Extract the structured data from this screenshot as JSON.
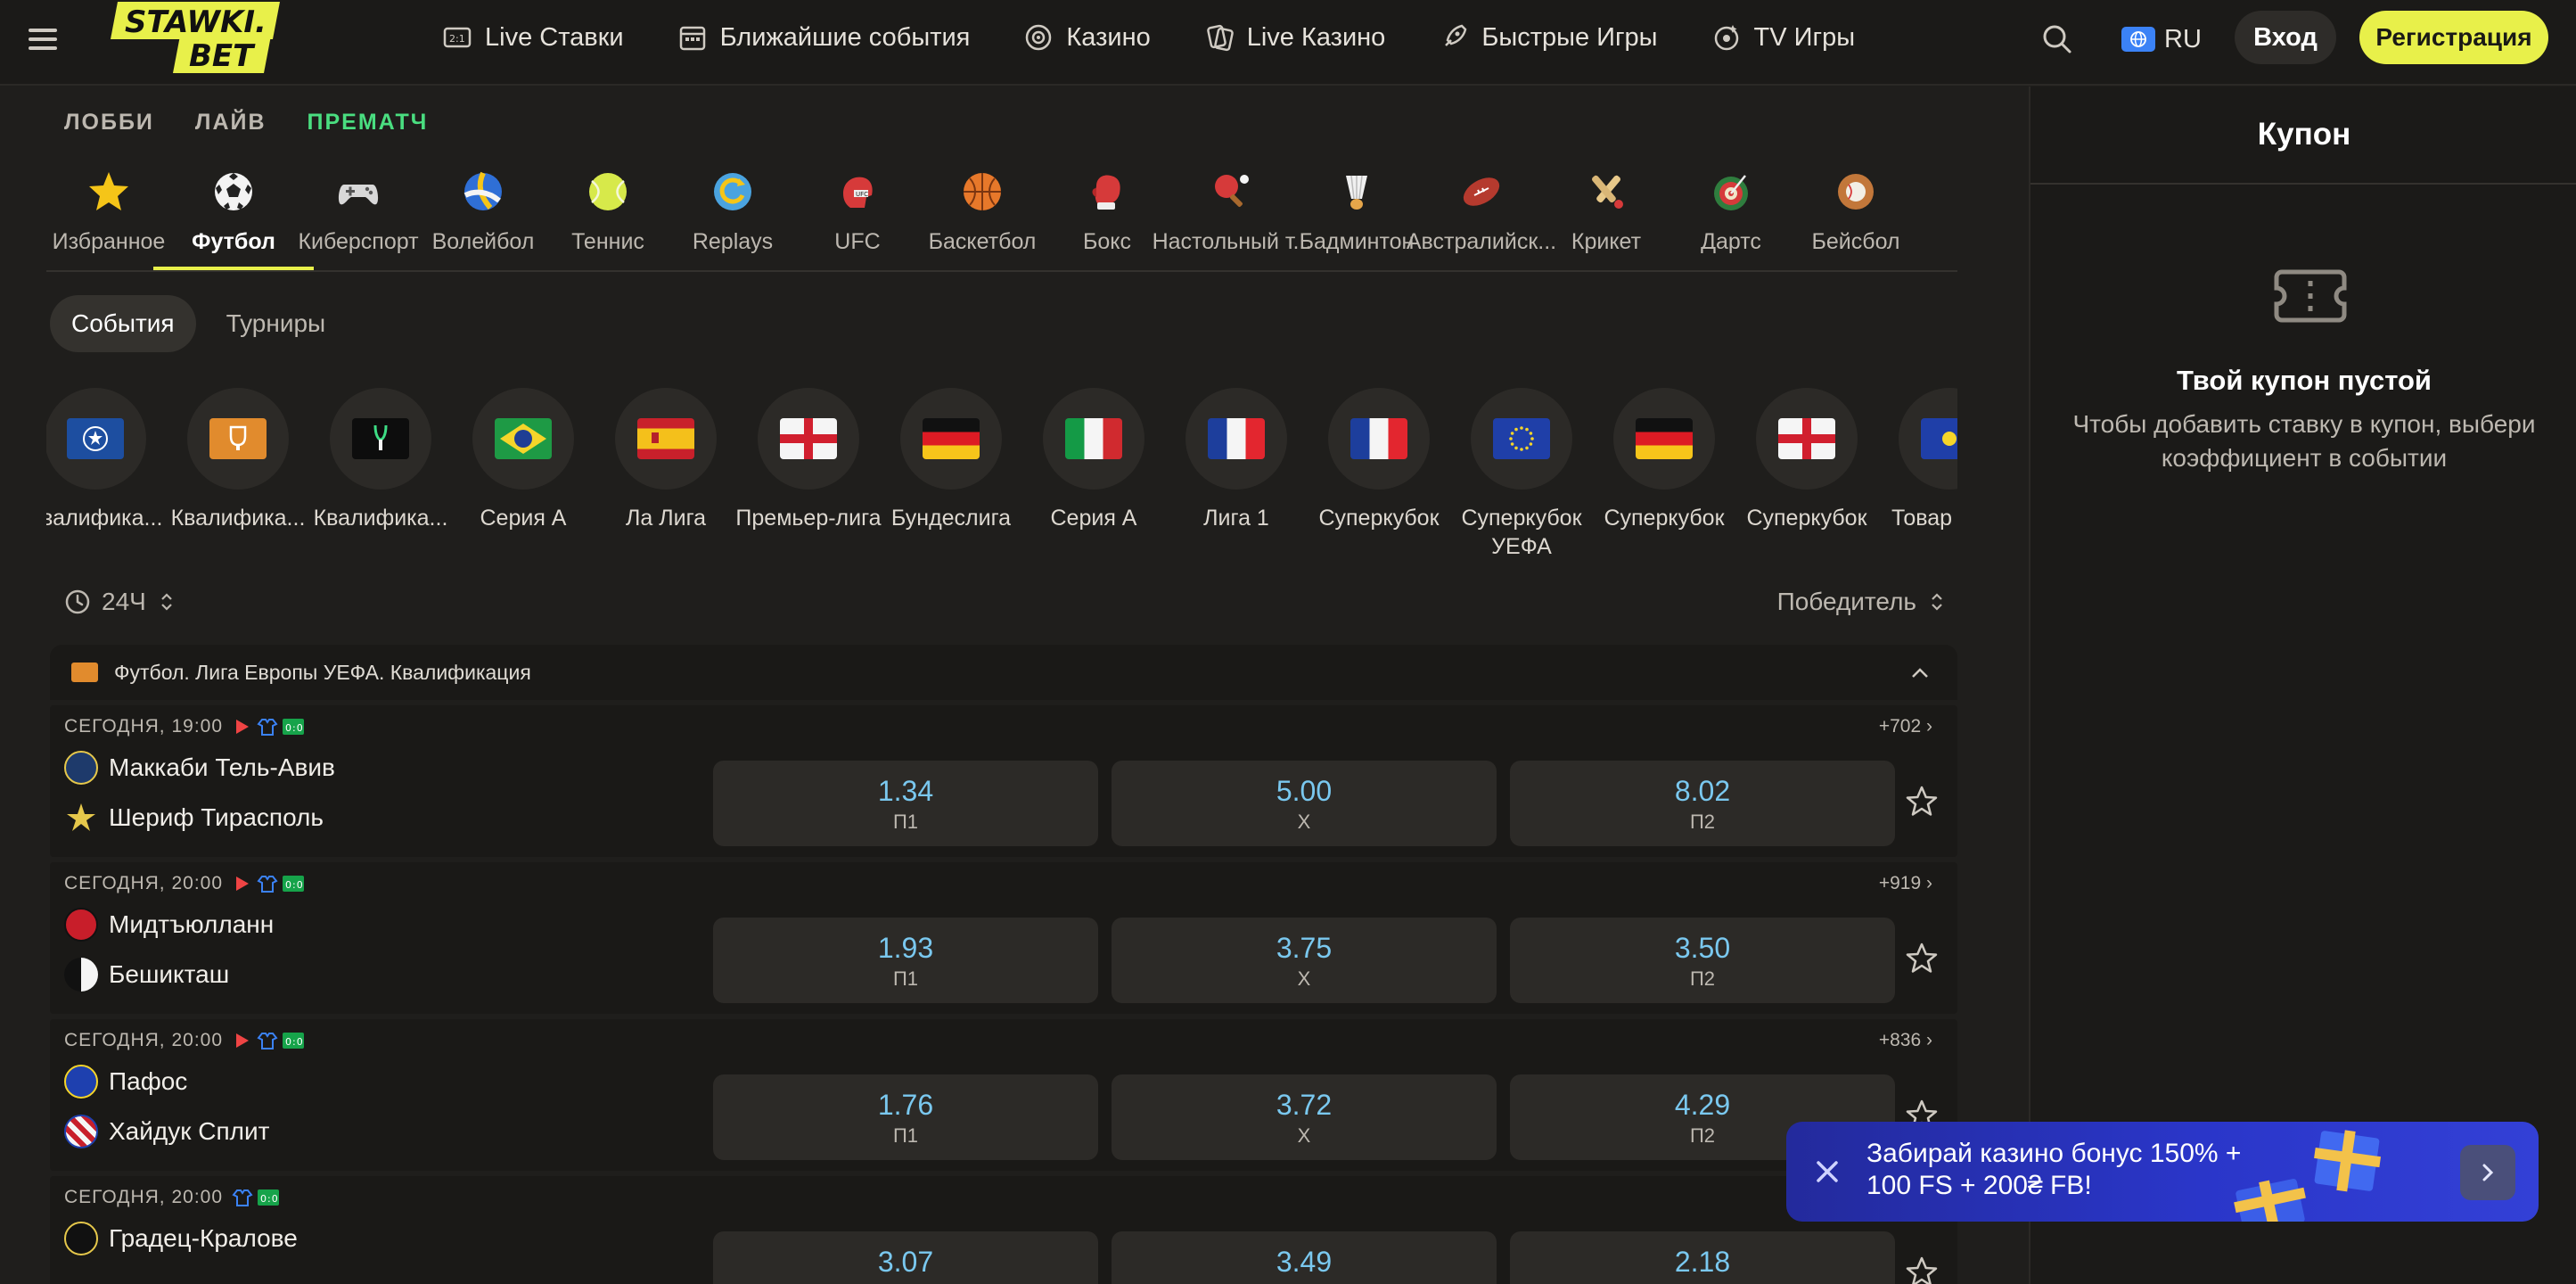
{
  "header": {
    "logo_line1": "STAWKI.",
    "logo_line2": "BET",
    "nav": [
      {
        "label": "Live Ставки",
        "icon": "live-score-icon"
      },
      {
        "label": "Ближайшие события",
        "icon": "calendar-icon"
      },
      {
        "label": "Казино",
        "icon": "roulette-icon"
      },
      {
        "label": "Live Казино",
        "icon": "cards-icon"
      },
      {
        "label": "Быстрые Игры",
        "icon": "rocket-icon"
      },
      {
        "label": "TV Игры",
        "icon": "tv-games-icon"
      }
    ],
    "lang": "RU",
    "login": "Вход",
    "register": "Регистрация"
  },
  "subtabs": [
    {
      "label": "ЛОББИ",
      "active": false
    },
    {
      "label": "ЛАЙВ",
      "active": false
    },
    {
      "label": "ПРЕМАТЧ",
      "active": true
    }
  ],
  "sports": [
    {
      "label": "Избранное",
      "icon": "star-icon"
    },
    {
      "label": "Футбол",
      "icon": "soccer-ball-icon",
      "active": true
    },
    {
      "label": "Киберспорт",
      "icon": "gamepad-icon"
    },
    {
      "label": "Волейбол",
      "icon": "volleyball-icon"
    },
    {
      "label": "Теннис",
      "icon": "tennis-ball-icon"
    },
    {
      "label": "Replays",
      "icon": "replays-icon"
    },
    {
      "label": "UFC",
      "icon": "ufc-helmet-icon"
    },
    {
      "label": "Баскетбол",
      "icon": "basketball-icon"
    },
    {
      "label": "Бокс",
      "icon": "boxing-glove-icon"
    },
    {
      "label": "Настольный т...",
      "icon": "table-tennis-icon"
    },
    {
      "label": "Бадминтон",
      "icon": "shuttlecock-icon"
    },
    {
      "label": "Австралийск...",
      "icon": "rugby-ball-icon"
    },
    {
      "label": "Крикет",
      "icon": "cricket-icon"
    },
    {
      "label": "Дартс",
      "icon": "darts-icon"
    },
    {
      "label": "Бейсбол",
      "icon": "baseball-icon"
    }
  ],
  "filter_tabs": [
    {
      "label": "События",
      "active": true
    },
    {
      "label": "Турниры",
      "active": false
    }
  ],
  "leagues": [
    {
      "label": "Квалифика...",
      "icon": "champions-league-icon"
    },
    {
      "label": "Квалифика...",
      "icon": "europa-league-icon"
    },
    {
      "label": "Квалифика...",
      "icon": "conference-league-icon"
    },
    {
      "label": "Серия А",
      "icon": "flag-brazil-icon"
    },
    {
      "label": "Ла Лига",
      "icon": "flag-spain-icon"
    },
    {
      "label": "Премьер-лига",
      "icon": "flag-england-icon"
    },
    {
      "label": "Бундеслига",
      "icon": "flag-germany-icon"
    },
    {
      "label": "Серия А",
      "icon": "flag-italy-icon"
    },
    {
      "label": "Лига 1",
      "icon": "flag-france-icon"
    },
    {
      "label": "Суперкубок",
      "icon": "flag-france-icon"
    },
    {
      "label": "Суперкубок УЕФА",
      "icon": "flag-eu-icon"
    },
    {
      "label": "Суперкубок",
      "icon": "flag-germany-icon"
    },
    {
      "label": "Суперкубок",
      "icon": "flag-england-icon"
    },
    {
      "label": "Товар матч",
      "icon": "friendly-icon"
    }
  ],
  "filters": {
    "time": "24Ч",
    "market": "Победитель"
  },
  "group": {
    "title": "Футбол. Лига Европы УЕФА. Квалификация"
  },
  "matches": [
    {
      "time": "СЕГОДНЯ, 19:00",
      "more": "+702",
      "team1": "Маккаби Тель-Авив",
      "team2": "Шериф Тирасполь",
      "odds": [
        {
          "v": "1.34",
          "l": "П1"
        },
        {
          "v": "5.00",
          "l": "X"
        },
        {
          "v": "8.02",
          "l": "П2"
        }
      ]
    },
    {
      "time": "СЕГОДНЯ, 20:00",
      "more": "+919",
      "team1": "Мидтъюлланн",
      "team2": "Бешикташ",
      "odds": [
        {
          "v": "1.93",
          "l": "П1"
        },
        {
          "v": "3.75",
          "l": "X"
        },
        {
          "v": "3.50",
          "l": "П2"
        }
      ]
    },
    {
      "time": "СЕГОДНЯ, 20:00",
      "more": "+836",
      "team1": "Пафос",
      "team2": "Хайдук Сплит",
      "odds": [
        {
          "v": "1.76",
          "l": "П1"
        },
        {
          "v": "3.72",
          "l": "X"
        },
        {
          "v": "4.29",
          "l": "П2"
        }
      ]
    },
    {
      "time": "СЕГОДНЯ, 20:00",
      "more": "",
      "team1": "Градец-Кралове",
      "team2": "",
      "odds": [
        {
          "v": "3.07",
          "l": ""
        },
        {
          "v": "3.49",
          "l": ""
        },
        {
          "v": "2.18",
          "l": ""
        }
      ]
    }
  ],
  "coupon": {
    "title": "Купон",
    "empty_title": "Твой купон пустой",
    "hint": "Чтобы добавить ставку в купон, выбери коэффициент в событии"
  },
  "promo": {
    "text": "Забирай казино бонус 150% + 100 FS + 200₴ FB!"
  },
  "colors": {
    "accent_yellow": "#e8f04a",
    "active_green": "#4ade80",
    "odds_blue": "#7ac8ef",
    "promo_blue": "#2a36c9"
  }
}
